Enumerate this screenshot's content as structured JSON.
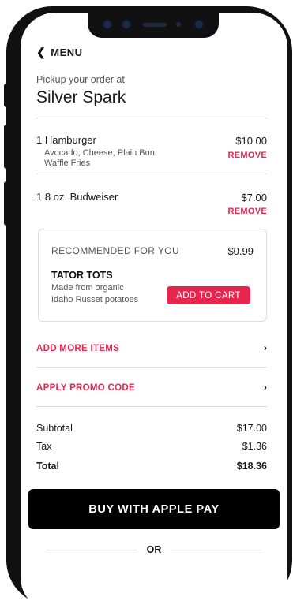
{
  "header": {
    "back_label": "MENU",
    "pickup_label": "Pickup your order at",
    "store_name": "Silver Spark"
  },
  "order_items": [
    {
      "name": "1 Hamburger",
      "description_line1": "Avocado, Cheese, Plain Bun,",
      "description_line2": "Waffle Fries",
      "price": "$10.00",
      "remove_label": "REMOVE"
    },
    {
      "name": "1 8 oz. Budweiser",
      "price": "$7.00",
      "remove_label": "REMOVE"
    }
  ],
  "recommendation": {
    "heading": "RECOMMENDED FOR YOU",
    "price": "$0.99",
    "name": "TATOR TOTS",
    "description_line1": "Made from organic",
    "description_line2": "Idaho Russet potatoes",
    "add_label": "ADD TO CART"
  },
  "links": {
    "add_more": "ADD MORE ITEMS",
    "promo": "APPLY PROMO CODE"
  },
  "summary": {
    "subtotal_label": "Subtotal",
    "subtotal_value": "$17.00",
    "tax_label": "Tax",
    "tax_value": "$1.36",
    "total_label": "Total",
    "total_value": "$18.36"
  },
  "pay_button_label": "BUY WITH APPLE PAY",
  "divider_label": "OR",
  "colors": {
    "accent": "#e8254f",
    "pay_button": "#000000",
    "device_frame": "#111111"
  },
  "icons": {
    "back": "chevron-left-icon",
    "link_arrow": "chevron-right-icon"
  }
}
